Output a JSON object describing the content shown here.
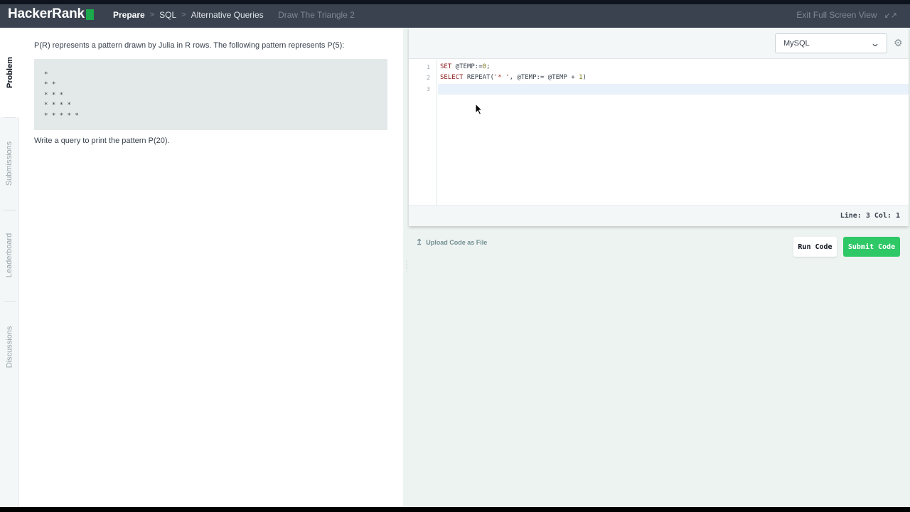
{
  "header": {
    "logo_text": "HackerRank",
    "breadcrumbs": [
      "Prepare",
      "SQL",
      "Alternative Queries",
      "Draw The Triangle 2"
    ],
    "fullscreen_label": "Exit Full Screen View"
  },
  "sidebar": {
    "tabs": [
      {
        "label": "Problem",
        "active": true
      },
      {
        "label": "Submissions",
        "active": false
      },
      {
        "label": "Leaderboard",
        "active": false
      },
      {
        "label": "Discussions",
        "active": false
      }
    ]
  },
  "problem": {
    "description": "P(R) represents a pattern drawn by Julia in R rows. The following pattern represents P(5):",
    "pattern_lines": [
      "*",
      "* *",
      "* * *",
      "* * * *",
      "* * * * *"
    ],
    "task": "Write a query to print the pattern P(20)."
  },
  "editor": {
    "language": "MySQL",
    "line_numbers": [
      "1",
      "2",
      "3"
    ],
    "code_lines": [
      "SET @TEMP:=0;",
      "SELECT REPEAT('* ', @TEMP:= @TEMP + 1)",
      ""
    ],
    "status": "Line: 3 Col: 1"
  },
  "actions": {
    "upload_label": "Upload Code as File",
    "run_label": "Run Code",
    "submit_label": "Submit Code"
  },
  "colors": {
    "topbar": "#39424e",
    "brand_green": "#1ba94c",
    "submit_green": "#2ec866"
  }
}
